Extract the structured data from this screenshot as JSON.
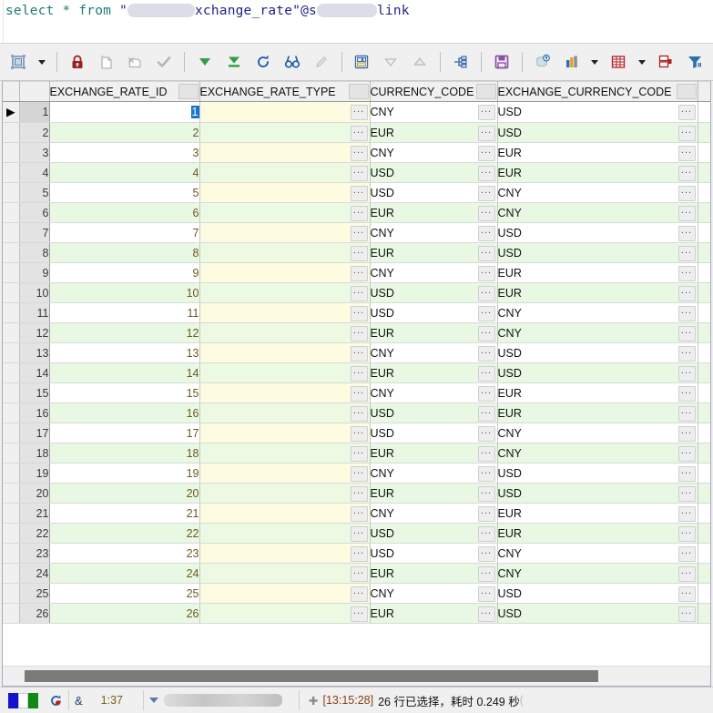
{
  "editor": {
    "sql_prefix": "select * from ",
    "quote": "\"",
    "redacted_schema": "",
    "table_fragment": "xchange_rate",
    "quote_close": "\"@",
    "at_prefix": "s",
    "redacted_dblink": "",
    "link_suffix": "link"
  },
  "toolbar": {
    "items": [
      {
        "name": "export-data-button",
        "label": "Export Data"
      },
      {
        "name": "export-dropdown-arrow",
        "label": "Export options"
      },
      {
        "name": "lock-record-button",
        "label": "Lock"
      },
      {
        "name": "add-record-button",
        "label": "Add Record"
      },
      {
        "name": "delete-record-button",
        "label": "Delete Record"
      },
      {
        "name": "confirm-button",
        "label": "Confirm"
      },
      {
        "name": "fetch-next-page-button",
        "label": "Fetch Next Page"
      },
      {
        "name": "fetch-all-button",
        "label": "Fetch All"
      },
      {
        "name": "refresh-button",
        "label": "Refresh"
      },
      {
        "name": "find-button",
        "label": "Find"
      },
      {
        "name": "clear-filter-button",
        "label": "Clear"
      },
      {
        "name": "single-record-view-button",
        "label": "Single Record View"
      },
      {
        "name": "page-down-button",
        "label": "Next"
      },
      {
        "name": "page-up-button",
        "label": "Previous"
      },
      {
        "name": "sql-plan-button",
        "label": "Explain Plan"
      },
      {
        "name": "save-button",
        "label": "Save"
      },
      {
        "name": "commit-button",
        "label": "Commit"
      },
      {
        "name": "chart-button",
        "label": "Chart"
      },
      {
        "name": "chart-dropdown-arrow",
        "label": "Chart options"
      },
      {
        "name": "grid-view-button",
        "label": "Grid View"
      },
      {
        "name": "grid-dropdown-arrow",
        "label": "Grid options"
      },
      {
        "name": "copy-rows-button",
        "label": "Copy Rows"
      },
      {
        "name": "filter-button",
        "label": "Filter"
      }
    ]
  },
  "grid": {
    "columns": [
      {
        "name": "EXCHANGE_RATE_ID",
        "key": "id"
      },
      {
        "name": "EXCHANGE_RATE_TYPE",
        "key": "type"
      },
      {
        "name": "CURRENCY_CODE",
        "key": "currency"
      },
      {
        "name": "EXCHANGE_CURRENCY_CODE",
        "key": "exchange_currency"
      }
    ],
    "selected_cell": {
      "row": 1,
      "column": "EXCHANGE_RATE_ID",
      "value": "1"
    },
    "ellipsis_label": "...",
    "current_row_marker": "▶",
    "rows": [
      {
        "n": "1",
        "id": "1",
        "type": "",
        "currency": "CNY",
        "exchange_currency": "USD"
      },
      {
        "n": "2",
        "id": "2",
        "type": "",
        "currency": "EUR",
        "exchange_currency": "USD"
      },
      {
        "n": "3",
        "id": "3",
        "type": "",
        "currency": "CNY",
        "exchange_currency": "EUR"
      },
      {
        "n": "4",
        "id": "4",
        "type": "",
        "currency": "USD",
        "exchange_currency": "EUR"
      },
      {
        "n": "5",
        "id": "5",
        "type": "",
        "currency": "USD",
        "exchange_currency": "CNY"
      },
      {
        "n": "6",
        "id": "6",
        "type": "",
        "currency": "EUR",
        "exchange_currency": "CNY"
      },
      {
        "n": "7",
        "id": "7",
        "type": "",
        "currency": "CNY",
        "exchange_currency": "USD"
      },
      {
        "n": "8",
        "id": "8",
        "type": "",
        "currency": "EUR",
        "exchange_currency": "USD"
      },
      {
        "n": "9",
        "id": "9",
        "type": "",
        "currency": "CNY",
        "exchange_currency": "EUR"
      },
      {
        "n": "10",
        "id": "10",
        "type": "",
        "currency": "USD",
        "exchange_currency": "EUR"
      },
      {
        "n": "11",
        "id": "11",
        "type": "",
        "currency": "USD",
        "exchange_currency": "CNY"
      },
      {
        "n": "12",
        "id": "12",
        "type": "",
        "currency": "EUR",
        "exchange_currency": "CNY"
      },
      {
        "n": "13",
        "id": "13",
        "type": "",
        "currency": "CNY",
        "exchange_currency": "USD"
      },
      {
        "n": "14",
        "id": "14",
        "type": "",
        "currency": "EUR",
        "exchange_currency": "USD"
      },
      {
        "n": "15",
        "id": "15",
        "type": "",
        "currency": "CNY",
        "exchange_currency": "EUR"
      },
      {
        "n": "16",
        "id": "16",
        "type": "",
        "currency": "USD",
        "exchange_currency": "EUR"
      },
      {
        "n": "17",
        "id": "17",
        "type": "",
        "currency": "USD",
        "exchange_currency": "CNY"
      },
      {
        "n": "18",
        "id": "18",
        "type": "",
        "currency": "EUR",
        "exchange_currency": "CNY"
      },
      {
        "n": "19",
        "id": "19",
        "type": "",
        "currency": "CNY",
        "exchange_currency": "USD"
      },
      {
        "n": "20",
        "id": "20",
        "type": "",
        "currency": "EUR",
        "exchange_currency": "USD"
      },
      {
        "n": "21",
        "id": "21",
        "type": "",
        "currency": "CNY",
        "exchange_currency": "EUR"
      },
      {
        "n": "22",
        "id": "22",
        "type": "",
        "currency": "USD",
        "exchange_currency": "EUR"
      },
      {
        "n": "23",
        "id": "23",
        "type": "",
        "currency": "USD",
        "exchange_currency": "CNY"
      },
      {
        "n": "24",
        "id": "24",
        "type": "",
        "currency": "EUR",
        "exchange_currency": "CNY"
      },
      {
        "n": "25",
        "id": "25",
        "type": "",
        "currency": "CNY",
        "exchange_currency": "USD"
      },
      {
        "n": "26",
        "id": "26",
        "type": "",
        "currency": "EUR",
        "exchange_currency": "USD"
      }
    ]
  },
  "statusbar": {
    "cursor_position": "1:37",
    "connection_redacted": "",
    "message_time": "[13:15:28]",
    "message_text": "26 行已选择，耗时 0.249 秒",
    "message_tail": "(",
    "pin_icon": "✛"
  },
  "colors": {
    "accent_blue": "#1675d1",
    "row_even": "#e8f8e3",
    "row_cream": "#fdfbe0",
    "toolbar_bg": "#f0f0f0",
    "green_arrow": "#1f9b3f",
    "lock_red": "#9c1f22",
    "save_purple": "#8e4fa8",
    "filter_blue": "#2a6fb0"
  }
}
